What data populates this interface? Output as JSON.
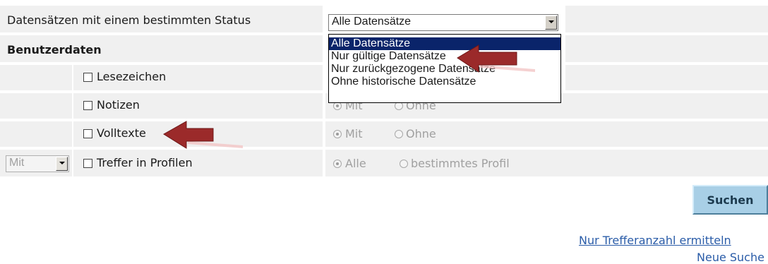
{
  "status_row": {
    "label": "Datensätzen mit einem bestimmten Status",
    "select_value": "Alle Datensätze",
    "options": [
      "Alle Datensätze",
      "Nur gültige Datensätze",
      "Nur zurückgezogene Datensätze",
      "Ohne historische Datensätze"
    ]
  },
  "section": {
    "title": "Benutzerdaten"
  },
  "rows": {
    "lesezeichen": {
      "label": "Lesezeichen"
    },
    "notizen": {
      "label": "Notizen",
      "opt_a": "Mit",
      "opt_b": "Ohne"
    },
    "volltexte": {
      "label": "Volltexte",
      "opt_a": "Mit",
      "opt_b": "Ohne"
    },
    "treffer": {
      "select_value": "Mit",
      "label": "Treffer in Profilen",
      "opt_a": "Alle",
      "opt_b": "bestimmtes Profil"
    }
  },
  "actions": {
    "search_button": "Suchen",
    "count_link": "Nur Trefferanzahl ermitteln",
    "new_search_link": "Neue Suche"
  },
  "colors": {
    "cell_bg": "#f0f0f0",
    "selected": "#0a246a",
    "link": "#2a5ca8",
    "button": "#a8cfe6",
    "arrow": "#9b2a2a"
  }
}
